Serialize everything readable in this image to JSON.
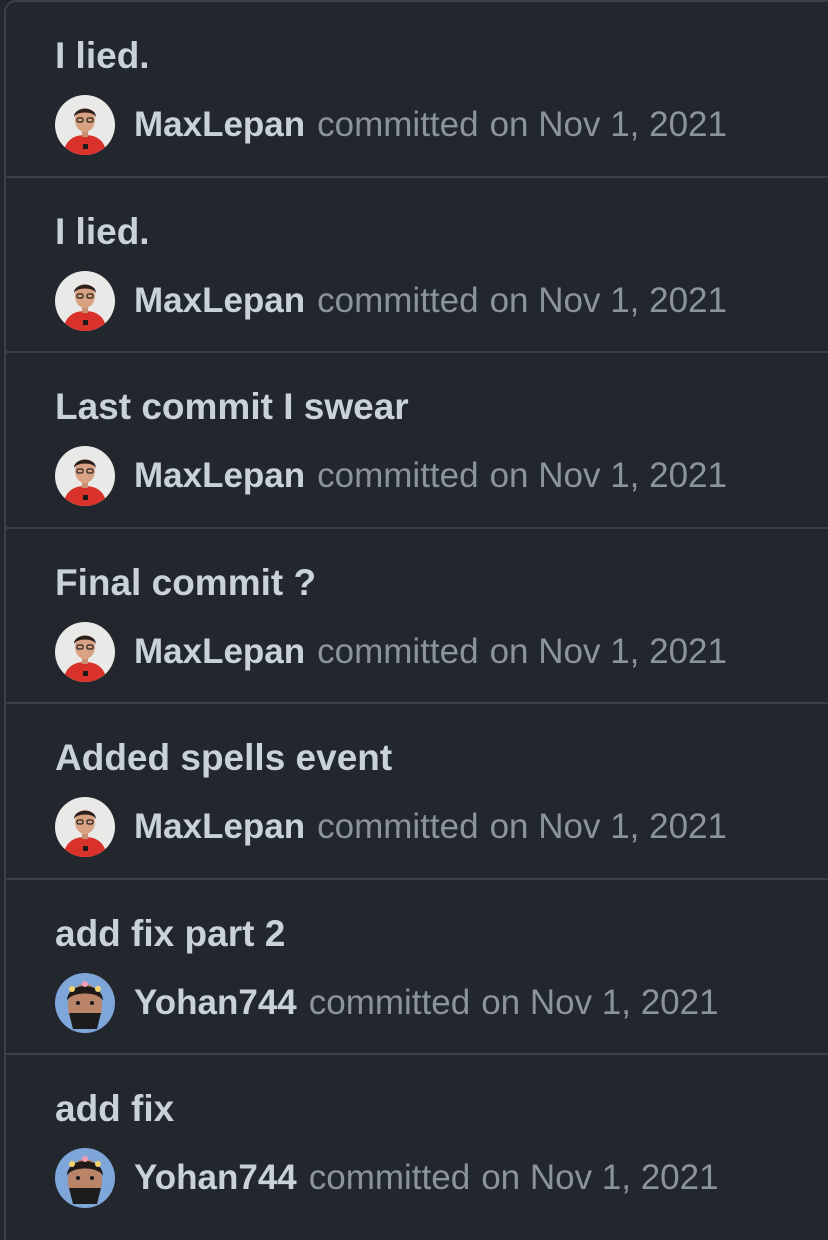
{
  "commits": [
    {
      "title": "I lied.",
      "author": "MaxLepan",
      "action": "committed",
      "date": "on Nov 1, 2021",
      "avatar_icon": "avatar-red-shirt-icon"
    },
    {
      "title": "I lied.",
      "author": "MaxLepan",
      "action": "committed",
      "date": "on Nov 1, 2021",
      "avatar_icon": "avatar-red-shirt-icon"
    },
    {
      "title": "Last commit I swear",
      "author": "MaxLepan",
      "action": "committed",
      "date": "on Nov 1, 2021",
      "avatar_icon": "avatar-red-shirt-icon"
    },
    {
      "title": "Final commit ?",
      "author": "MaxLepan",
      "action": "committed",
      "date": "on Nov 1, 2021",
      "avatar_icon": "avatar-red-shirt-icon"
    },
    {
      "title": "Added spells event",
      "author": "MaxLepan",
      "action": "committed",
      "date": "on Nov 1, 2021",
      "avatar_icon": "avatar-red-shirt-icon"
    },
    {
      "title": "add fix part 2",
      "author": "Yohan744",
      "action": "committed",
      "date": "on Nov 1, 2021",
      "avatar_icon": "avatar-masked-face-icon"
    },
    {
      "title": "add fix",
      "author": "Yohan744",
      "action": "committed",
      "date": "on Nov 1, 2021",
      "avatar_icon": "avatar-masked-face-icon"
    }
  ],
  "colors": {
    "background": "#22262d",
    "border": "#3a3f48",
    "title_text": "#c9d1d9",
    "muted_text": "#8b949e"
  }
}
